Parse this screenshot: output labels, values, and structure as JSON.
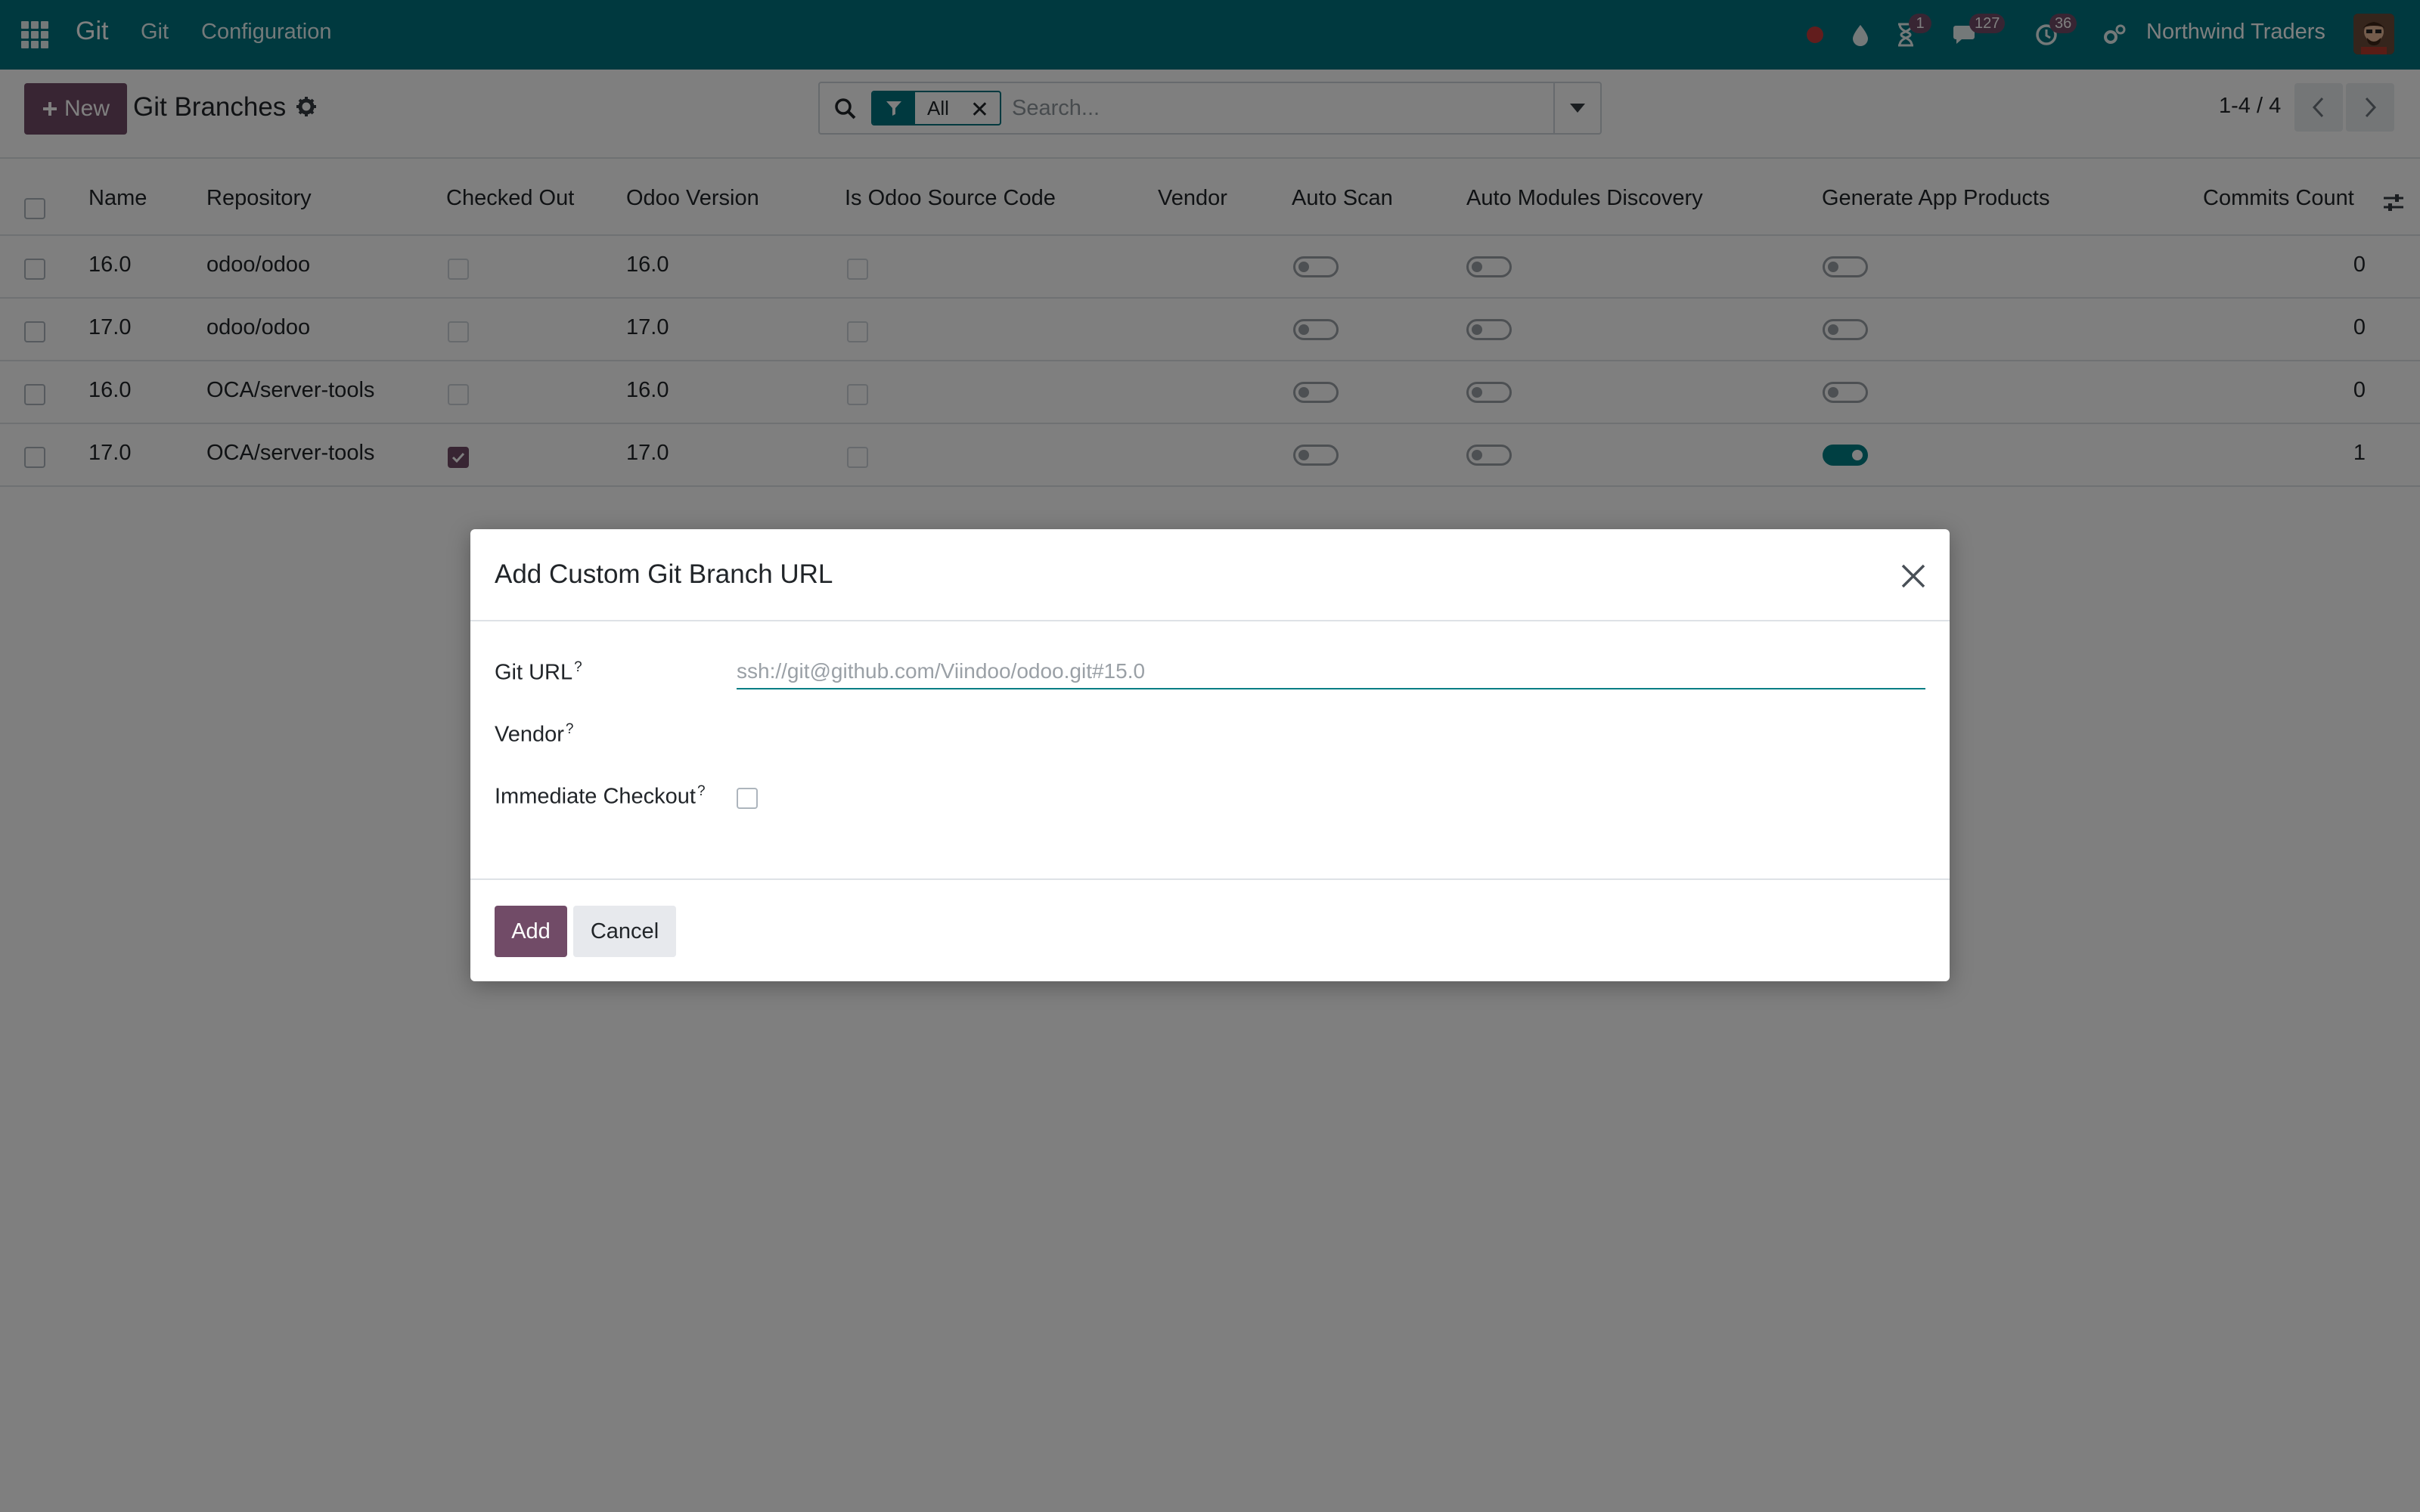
{
  "navbar": {
    "brand": "Git",
    "menus": [
      "Git",
      "Configuration"
    ],
    "activity_badge": "1",
    "messages_badge": "127",
    "timer_badge": "36",
    "company": "Northwind Traders"
  },
  "control_panel": {
    "new_label": "New",
    "title": "Git Branches",
    "search": {
      "facet": "All",
      "placeholder": "Search..."
    },
    "pager": "1-4 / 4"
  },
  "list": {
    "columns": [
      "Name",
      "Repository",
      "Checked Out",
      "Odoo Version",
      "Is Odoo Source Code",
      "Vendor",
      "Auto Scan",
      "Auto Modules Discovery",
      "Generate App Products",
      "Commits Count"
    ],
    "rows": [
      {
        "name": "16.0",
        "repository": "odoo/odoo",
        "checked_out": false,
        "odoo_version": "16.0",
        "is_source": false,
        "vendor": "",
        "auto_scan": false,
        "auto_discovery": false,
        "generate_products": false,
        "commits": "0"
      },
      {
        "name": "17.0",
        "repository": "odoo/odoo",
        "checked_out": false,
        "odoo_version": "17.0",
        "is_source": false,
        "vendor": "",
        "auto_scan": false,
        "auto_discovery": false,
        "generate_products": false,
        "commits": "0"
      },
      {
        "name": "16.0",
        "repository": "OCA/server-tools",
        "checked_out": false,
        "odoo_version": "16.0",
        "is_source": false,
        "vendor": "",
        "auto_scan": false,
        "auto_discovery": false,
        "generate_products": false,
        "commits": "0"
      },
      {
        "name": "17.0",
        "repository": "OCA/server-tools",
        "checked_out": true,
        "odoo_version": "17.0",
        "is_source": false,
        "vendor": "",
        "auto_scan": false,
        "auto_discovery": false,
        "generate_products": true,
        "commits": "1"
      }
    ]
  },
  "dialog": {
    "title": "Add Custom Git Branch URL",
    "git_url_label": "Git URL",
    "git_url_placeholder": "ssh://git@github.com/Viindoo/odoo.git#15.0",
    "vendor_label": "Vendor",
    "checkout_label": "Immediate Checkout",
    "help_mark": "?",
    "add_label": "Add",
    "cancel_label": "Cancel"
  },
  "colors": {
    "navbar": "#00737f",
    "primary": "#714b67",
    "toggle_on": "#017e84"
  }
}
